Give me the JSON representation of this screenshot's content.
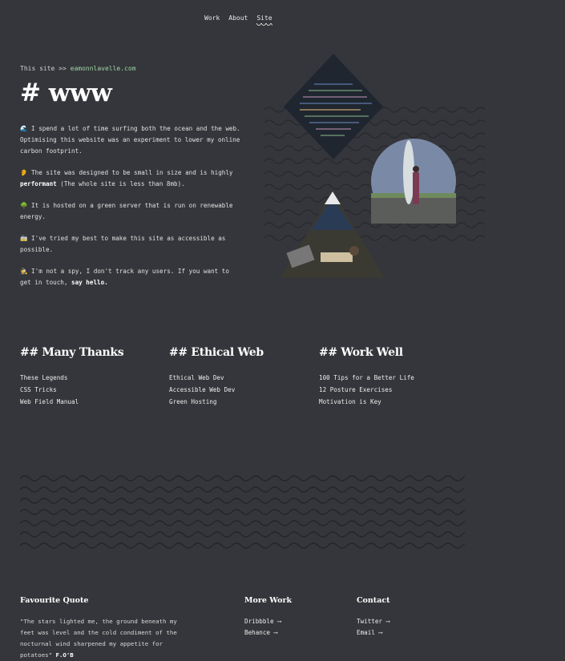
{
  "nav": {
    "work": "Work",
    "about": "About",
    "site": "Site"
  },
  "crumb": {
    "prefix": "This site >>",
    "link": "eamonnlavelle.com"
  },
  "title": "# www",
  "intro": [
    {
      "icon": "🌊",
      "text": "I spend a lot of time surfing both the ocean and the web. Optimising this website was an experiment to lower my online carbon footprint."
    },
    {
      "icon": "👂",
      "text_pre": "The site was designed to be small in size and is highly ",
      "bold": "performant",
      "text_post": " (The whole site is less than 8mb)."
    },
    {
      "icon": "🌳",
      "text": "It is hosted on a green server that is run on renewable energy."
    },
    {
      "icon": "🚋",
      "text": "I've tried my best to make this site as accessible as possible."
    },
    {
      "icon": "🕵",
      "text_pre": "I'm not a spy, I don't track any users. If you want to get in touch, ",
      "bold": "say hello."
    }
  ],
  "sections": [
    {
      "title": "## Many Thanks",
      "items": [
        "These Legends",
        "CSS Tricks",
        "Web Field Manual"
      ]
    },
    {
      "title": "## Ethical Web",
      "items": [
        "Ethical Web Dev",
        "Accessible Web Dev",
        "Green Hosting"
      ]
    },
    {
      "title": "## Work Well",
      "items": [
        "100 Tips for a Better Life",
        "12 Posture Exercises",
        "Motivation is Key"
      ]
    }
  ],
  "footer": {
    "quote_title": "Favourite Quote",
    "quote": "\"The stars lighted me, the ground beneath my feet was level and the cold condiment of the nocturnal wind sharpened my appetite for potatoes\"",
    "quote_author": "F.O'B",
    "more_title": "More Work",
    "more": [
      "Dribbble ⟶",
      "Behance ⟶"
    ],
    "contact_title": "Contact",
    "contact": [
      "Twitter ⟶",
      "Email ⟶"
    ]
  }
}
